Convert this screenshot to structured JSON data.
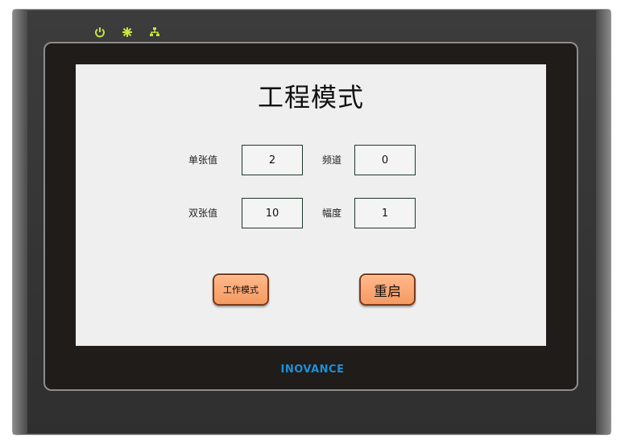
{
  "screen": {
    "title": "工程模式",
    "fields": [
      {
        "label": "单张值",
        "value": "2"
      },
      {
        "label": "频道",
        "value": "0"
      },
      {
        "label": "双张值",
        "value": "10"
      },
      {
        "label": "幅度",
        "value": "1"
      }
    ],
    "buttons": {
      "work_mode": "工作模式",
      "restart": "重启"
    }
  },
  "device": {
    "brand": "INOVANCE",
    "indicators": [
      "power-icon",
      "run-icon",
      "network-icon"
    ],
    "indicator_color": "#c8e640",
    "brand_color": "#1e8fd8",
    "button_color": "#f59a62"
  }
}
